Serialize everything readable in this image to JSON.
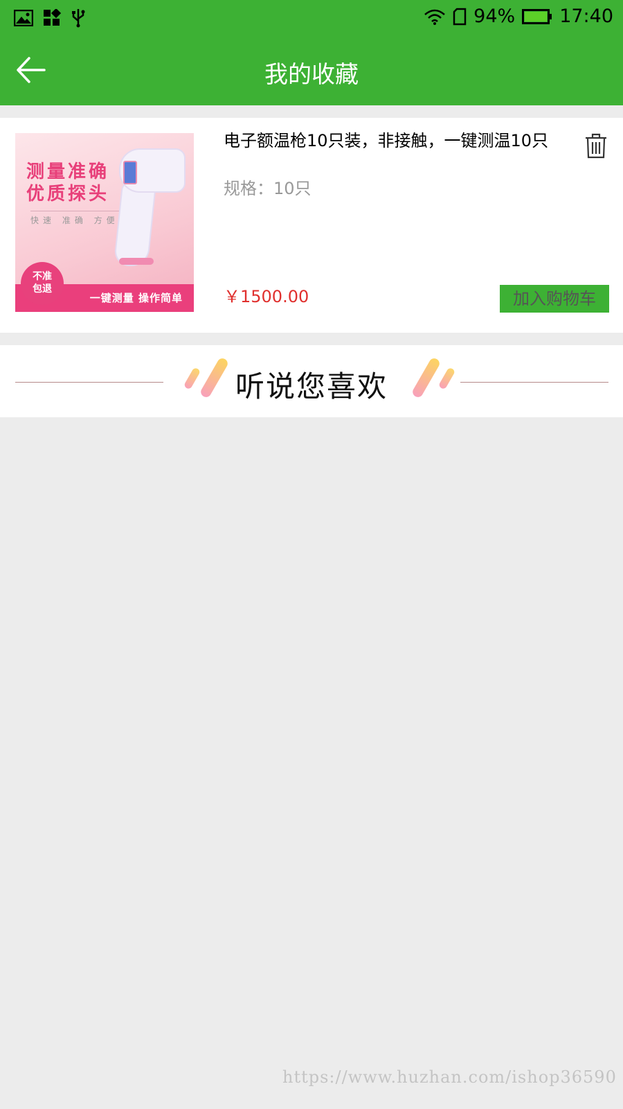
{
  "status_bar": {
    "battery_percent": "94%",
    "time": "17:40",
    "left_icons": [
      "image-icon",
      "apps-icon",
      "usb-icon"
    ],
    "right_icons": [
      "wifi-icon",
      "sim-icon",
      "battery-icon"
    ]
  },
  "header": {
    "title": "我的收藏",
    "back_icon": "arrow-left-icon"
  },
  "favorites": [
    {
      "title": "电子额温枪10只装，非接触，一键测温10只",
      "spec": "规格：10只",
      "price": "￥1500.00",
      "add_to_cart_label": "加入购物车",
      "image": {
        "headline_line1": "测量准确",
        "headline_line2": "优质探头",
        "subline": "快速 准确 方便",
        "badge_line1": "不准",
        "badge_line2": "包退",
        "strip_text": "一键测量 操作简单"
      }
    }
  ],
  "recommend": {
    "title": "听说您喜欢"
  },
  "watermark": "https://www.huzhan.com/ishop36590",
  "colors": {
    "brand_green": "#3db134",
    "price_red": "#e0302e",
    "background": "#ececec"
  }
}
